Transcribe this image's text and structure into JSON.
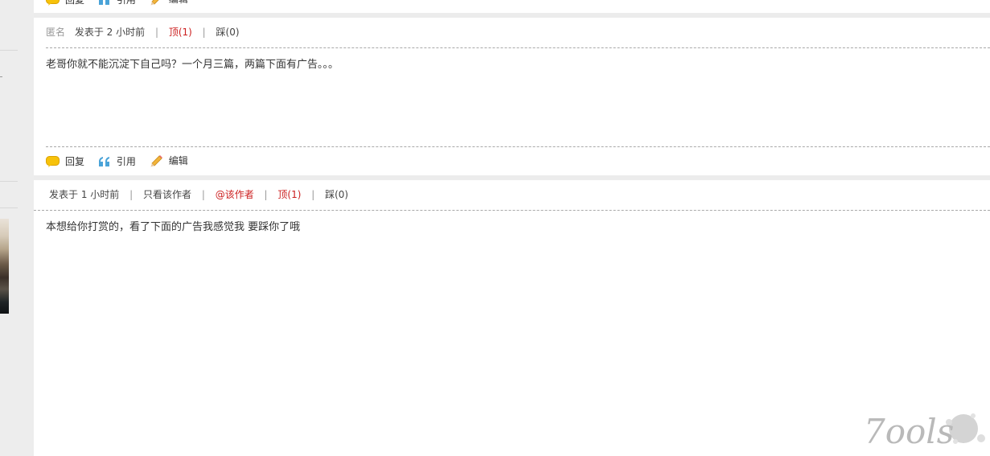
{
  "comments": [
    {
      "author": "匿名",
      "posted": "发表于 2 小时前",
      "up": "顶(1)",
      "down": "踩(0)",
      "body": "老哥你就不能沉淀下自己吗？一个月三篇，两篇下面有广告。。。"
    },
    {
      "posted": "发表于 1 小时前",
      "only_author": "只看该作者",
      "at_author": "@该作者",
      "up": "顶(1)",
      "down": "踩(0)",
      "body": "本想给你打赏的，看了下面的广告我感觉我 要踩你了哦"
    }
  ],
  "actions": {
    "reply": "回复",
    "quote": "引用",
    "edit": "编辑"
  },
  "watermark": "7ools",
  "colors": {
    "accent_red": "#cc1f1f",
    "separator": "#ececec",
    "sidebar": "#ededed"
  }
}
